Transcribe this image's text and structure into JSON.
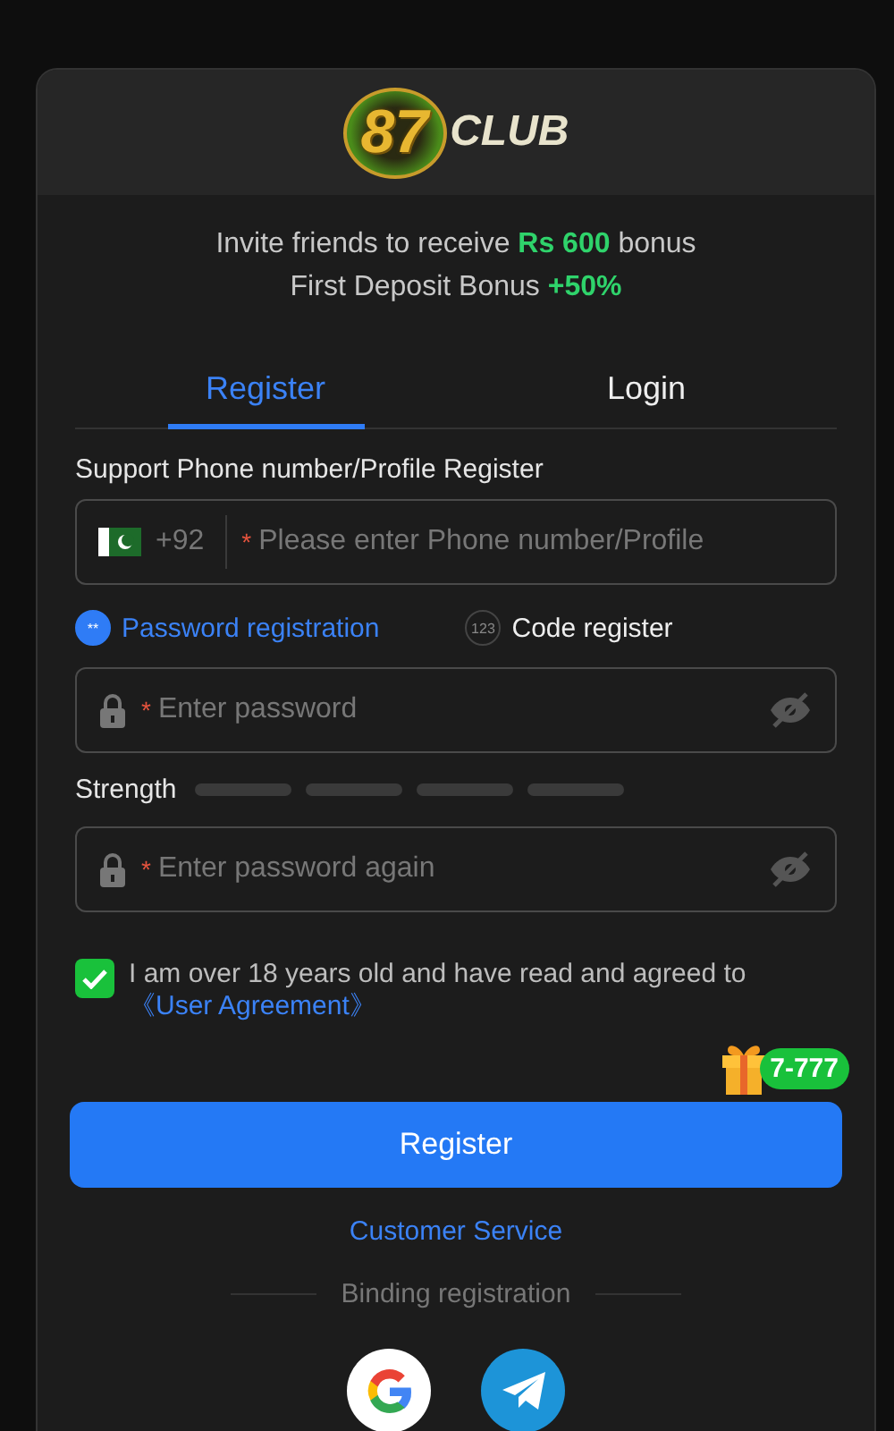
{
  "logo": {
    "number": "87",
    "word": "CLUB"
  },
  "promo": [
    "Invite friends to receive **Rs 600** bonus",
    "First Deposit Bonus **+50%**"
  ],
  "tabs": [
    {
      "label": "Register",
      "selected": true
    },
    {
      "label": "Login",
      "selected": false
    }
  ],
  "phone": {
    "label": "Support Phone number/Profile Register",
    "country_code": "+92",
    "required_mark": "*",
    "placeholder": "Please enter Phone number/Profile"
  },
  "methods": [
    {
      "kind": "password",
      "icon_text": "**",
      "label": "Password registration",
      "selected": true
    },
    {
      "kind": "code",
      "icon_text": "123",
      "label": "Code register",
      "selected": false
    }
  ],
  "password": {
    "required_mark": "*",
    "placeholder": "Enter password"
  },
  "strength": {
    "label": "Strength"
  },
  "confirm": {
    "required_mark": "*",
    "placeholder": "Enter password again"
  },
  "agreement": {
    "checked": true,
    "text": "I am over 18 years old and have read and agreed to",
    "link": "《User Agreement》"
  },
  "gift_badge": "7-777",
  "register_button": "Register",
  "customer_service": "Customer Service",
  "binding_label": "Binding registration",
  "social": [
    {
      "kind": "google"
    },
    {
      "kind": "telegram"
    }
  ]
}
